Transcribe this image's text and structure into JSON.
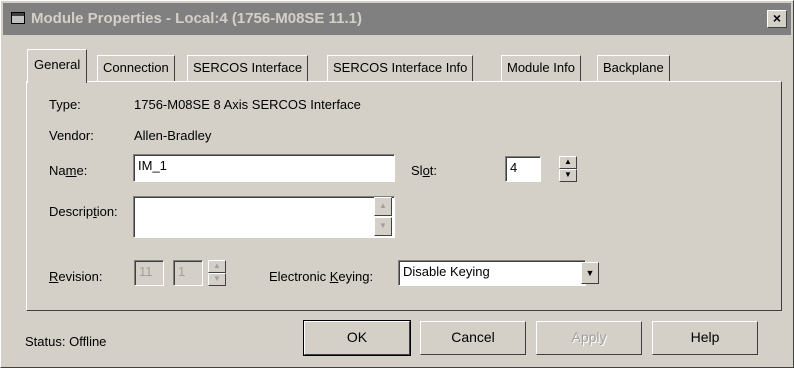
{
  "window": {
    "title": "Module Properties - Local:4 (1756-M08SE 11.1)",
    "close_glyph": "×"
  },
  "tabs": [
    {
      "label": "General",
      "active": true
    },
    {
      "label": "Connection"
    },
    {
      "label": "SERCOS Interface"
    },
    {
      "label": "SERCOS Interface Info"
    },
    {
      "label": "Module Info"
    },
    {
      "label": "Backplane"
    }
  ],
  "general": {
    "type_label": "Type:",
    "type_value": "1756-M08SE 8 Axis SERCOS Interface",
    "vendor_label": "Vendor:",
    "vendor_value": "Allen-Bradley",
    "name_label_pre": "Na",
    "name_label_u": "m",
    "name_label_post": "e:",
    "name_value": "IM_1",
    "slot_label_pre": "Sl",
    "slot_label_u": "o",
    "slot_label_post": "t:",
    "slot_value": "4",
    "description_label_pre": "Descrip",
    "description_label_u": "t",
    "description_label_post": "ion:",
    "description_value": "",
    "revision_label_u": "R",
    "revision_label_post": "evision:",
    "revision_major": "11",
    "revision_minor": "1",
    "keying_label_pre": "Electronic ",
    "keying_label_u": "K",
    "keying_label_post": "eying:",
    "keying_value": "Disable Keying"
  },
  "footer": {
    "status": "Status:  Offline",
    "ok": "OK",
    "cancel": "Cancel",
    "apply": "Apply",
    "help": "Help"
  },
  "icons": {
    "spin_up": "▲",
    "spin_down": "▼",
    "dropdown": "▼"
  }
}
